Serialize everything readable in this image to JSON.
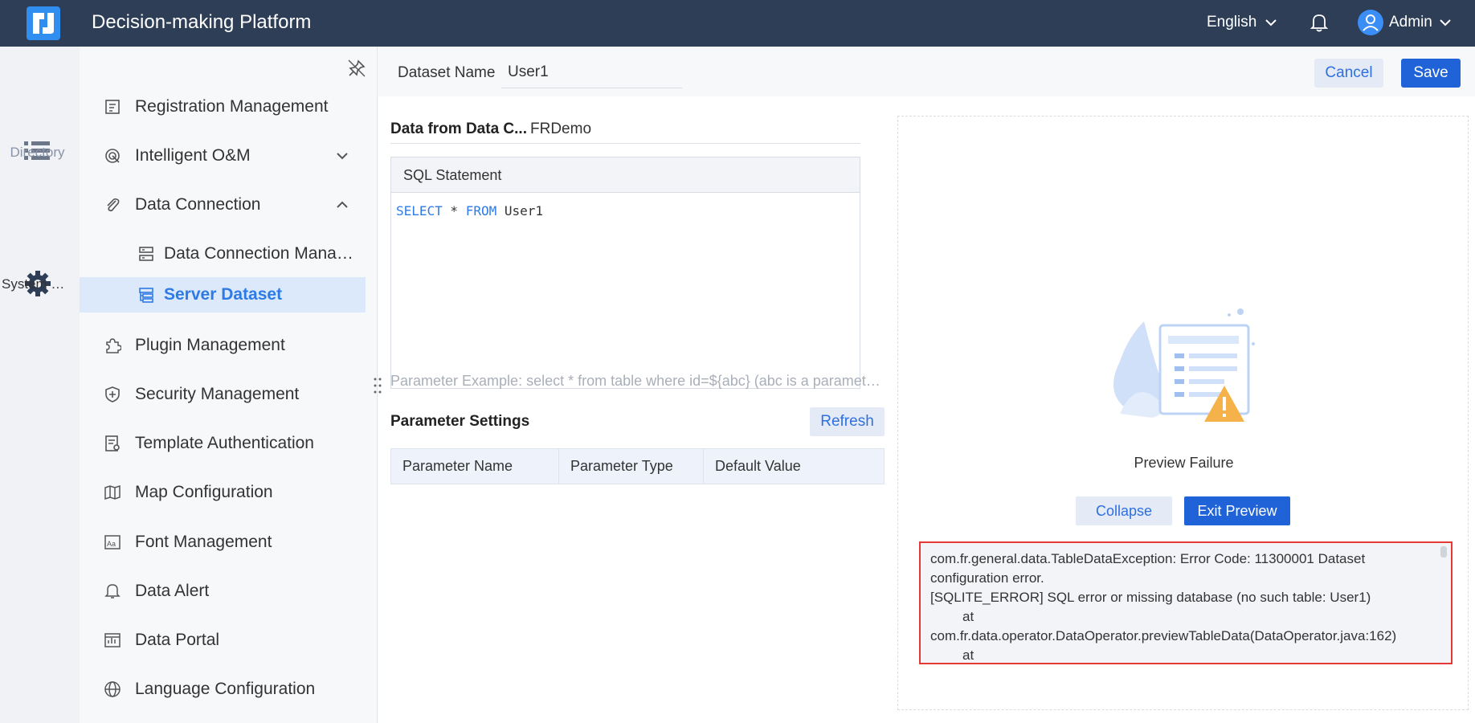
{
  "topbar": {
    "title": "Decision-making Platform",
    "language": "English",
    "user": "Admin"
  },
  "rail": {
    "directory": "Directory",
    "system": "System Management"
  },
  "sidebar": {
    "items": [
      {
        "label": "Registration Management"
      },
      {
        "label": "Intelligent O&M"
      },
      {
        "label": "Data Connection"
      },
      {
        "label": "Data Connection Management"
      },
      {
        "label": "Server Dataset"
      },
      {
        "label": "Plugin Management"
      },
      {
        "label": "Security Management"
      },
      {
        "label": "Template Authentication"
      },
      {
        "label": "Map Configuration"
      },
      {
        "label": "Font Management"
      },
      {
        "label": "Data Alert"
      },
      {
        "label": "Data Portal"
      },
      {
        "label": "Language Configuration"
      }
    ]
  },
  "editor": {
    "dataset_name_label": "Dataset Name",
    "dataset_name_value": "User1",
    "cancel": "Cancel",
    "save": "Save",
    "source_label": "Data from Data C...",
    "source_value": "FRDemo",
    "sql_header": "SQL Statement",
    "sql": {
      "kw1": "SELECT",
      "mid": " * ",
      "kw2": "FROM",
      "table": " User1"
    },
    "param_hint": "Parameter Example: select * from table where id=${abc} (abc is a parameter name)",
    "param_settings": "Parameter Settings",
    "refresh": "Refresh",
    "param_columns": [
      "Parameter Name",
      "Parameter Type",
      "Default Value"
    ]
  },
  "preview": {
    "status": "Preview Failure",
    "collapse": "Collapse",
    "exit": "Exit Preview",
    "error_lines": [
      "com.fr.general.data.TableDataException: Error Code: 11300001 Dataset",
      "configuration error.",
      "[SQLITE_ERROR] SQL error or missing database (no such table: User1)",
      "at",
      "com.fr.data.operator.DataOperator.previewTableData(DataOperator.java:162)",
      "at"
    ]
  }
}
